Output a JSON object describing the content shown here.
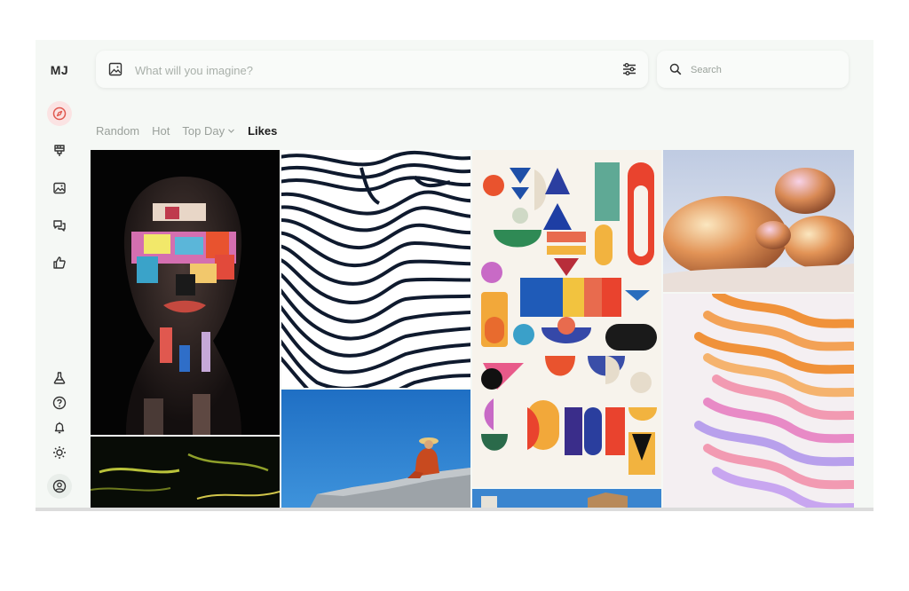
{
  "app": {
    "logo": "MJ"
  },
  "sidebar": {
    "items": [
      {
        "name": "explore",
        "icon": "compass-icon",
        "active": true
      },
      {
        "name": "create",
        "icon": "paintbrush-icon"
      },
      {
        "name": "organize",
        "icon": "image-icon"
      },
      {
        "name": "chat",
        "icon": "chat-bubbles-icon"
      },
      {
        "name": "likes",
        "icon": "thumbs-up-icon"
      }
    ],
    "bottom_items": [
      {
        "name": "labs",
        "icon": "flask-icon"
      },
      {
        "name": "help",
        "icon": "question-circle-icon"
      },
      {
        "name": "updates",
        "icon": "bell-icon"
      },
      {
        "name": "theme",
        "icon": "sun-icon"
      },
      {
        "name": "account",
        "icon": "user-circle-icon"
      }
    ]
  },
  "prompt": {
    "placeholder": "What will you imagine?"
  },
  "search": {
    "placeholder": "Search"
  },
  "tabs": [
    {
      "label": "Random",
      "active": false
    },
    {
      "label": "Hot",
      "active": false
    },
    {
      "label": "Top Day",
      "active": false,
      "has_dropdown": true
    },
    {
      "label": "Likes",
      "active": true
    }
  ],
  "gallery": [
    {
      "name": "painted-face-portrait"
    },
    {
      "name": "dark-abstract-strokes"
    },
    {
      "name": "black-white-fingerprint-waves"
    },
    {
      "name": "person-sitting-on-rock"
    },
    {
      "name": "geometric-shapes-collage"
    },
    {
      "name": "village-rooftop"
    },
    {
      "name": "iridescent-copper-blobs"
    },
    {
      "name": "orange-pink-wave-stripes"
    }
  ],
  "colors": {
    "accent": "#e0584f",
    "active_bg": "#fbe3e3",
    "app_bg": "#f5f8f5",
    "muted_text": "#9aa09b"
  }
}
